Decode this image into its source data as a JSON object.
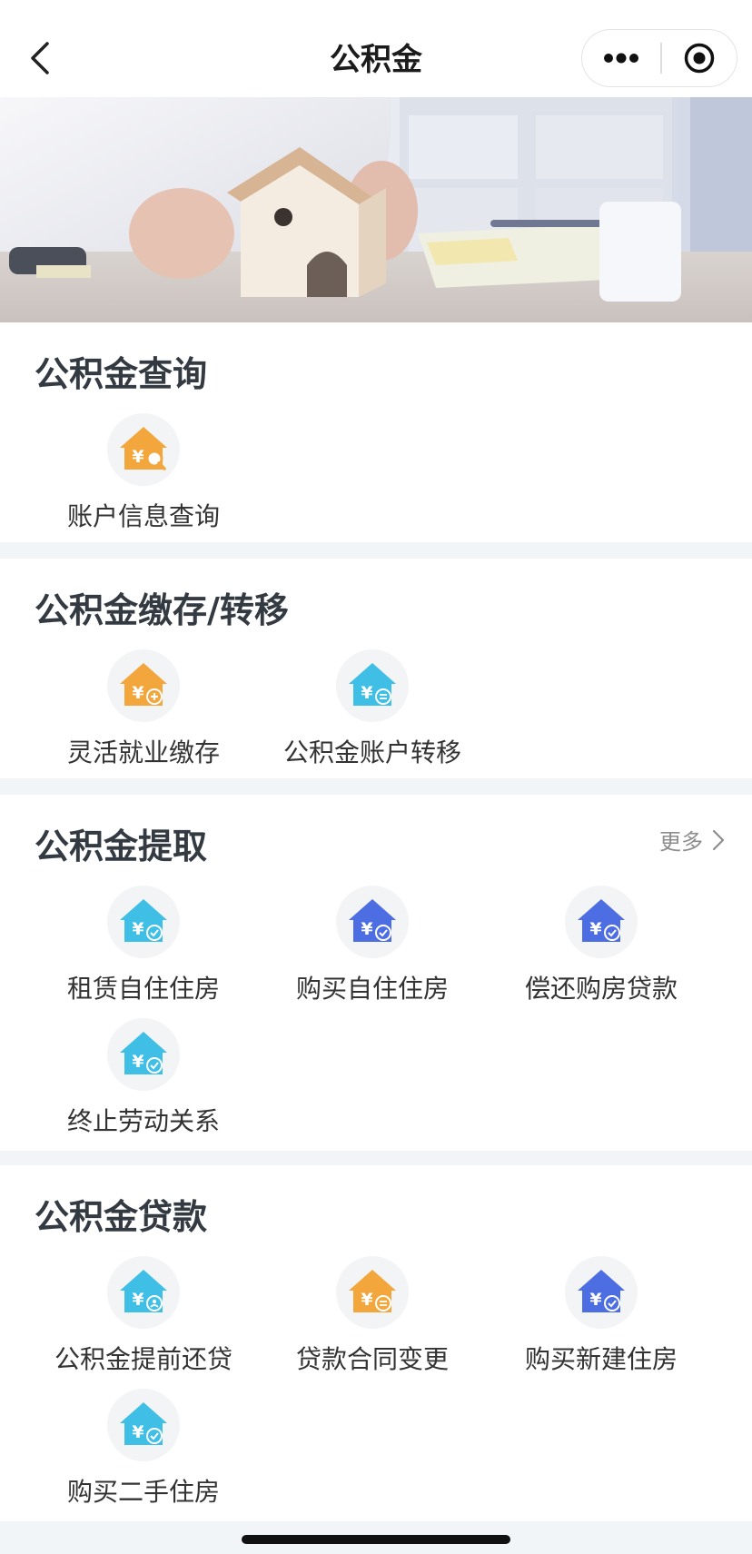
{
  "nav": {
    "title": "公积金",
    "back_icon": "chevron-left-icon",
    "more_icon": "more-dots-icon",
    "close_icon": "target-close-icon"
  },
  "banner": {
    "alt": "banner"
  },
  "colors": {
    "orange": "#f2a63c",
    "cyan": "#3fbfe6",
    "blue": "#4d6de3"
  },
  "sections": [
    {
      "title": "公积金查询",
      "items": [
        {
          "label": "账户信息查询",
          "color": "orange",
          "badge": "search"
        }
      ]
    },
    {
      "title": "公积金缴存/转移",
      "items": [
        {
          "label": "灵活就业缴存",
          "color": "orange",
          "badge": "plus"
        },
        {
          "label": "公积金账户转移",
          "color": "cyan",
          "badge": "transfer"
        }
      ]
    },
    {
      "title": "公积金提取",
      "more": "更多",
      "items": [
        {
          "label": "租赁自住住房",
          "color": "cyan",
          "badge": "check"
        },
        {
          "label": "购买自住住房",
          "color": "blue",
          "badge": "check"
        },
        {
          "label": "偿还购房贷款",
          "color": "blue",
          "badge": "check"
        },
        {
          "label": "终止劳动关系",
          "color": "cyan",
          "badge": "check"
        }
      ]
    },
    {
      "title": "公积金贷款",
      "items": [
        {
          "label": "公积金提前还贷",
          "color": "cyan",
          "badge": "person"
        },
        {
          "label": "贷款合同变更",
          "color": "orange",
          "badge": "transfer"
        },
        {
          "label": "购买新建住房",
          "color": "blue",
          "badge": "check"
        },
        {
          "label": "购买二手住房",
          "color": "cyan",
          "badge": "check"
        }
      ]
    }
  ]
}
